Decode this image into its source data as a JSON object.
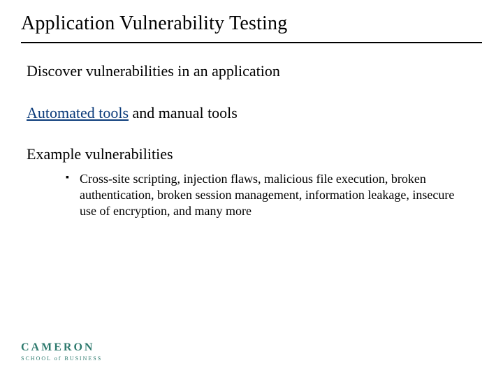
{
  "title": "Application Vulnerability Testing",
  "body": {
    "p1": "Discover vulnerabilities in an application",
    "p2_link": "Automated tools",
    "p2_rest": " and manual tools",
    "p3": "Example vulnerabilities",
    "bullet1": "Cross-site scripting, injection flaws, malicious file execution, broken authentication, broken session management, information leakage, insecure use of encryption, and many more"
  },
  "logo": {
    "name": "CAMERON",
    "sub": "SCHOOL of BUSINESS"
  }
}
